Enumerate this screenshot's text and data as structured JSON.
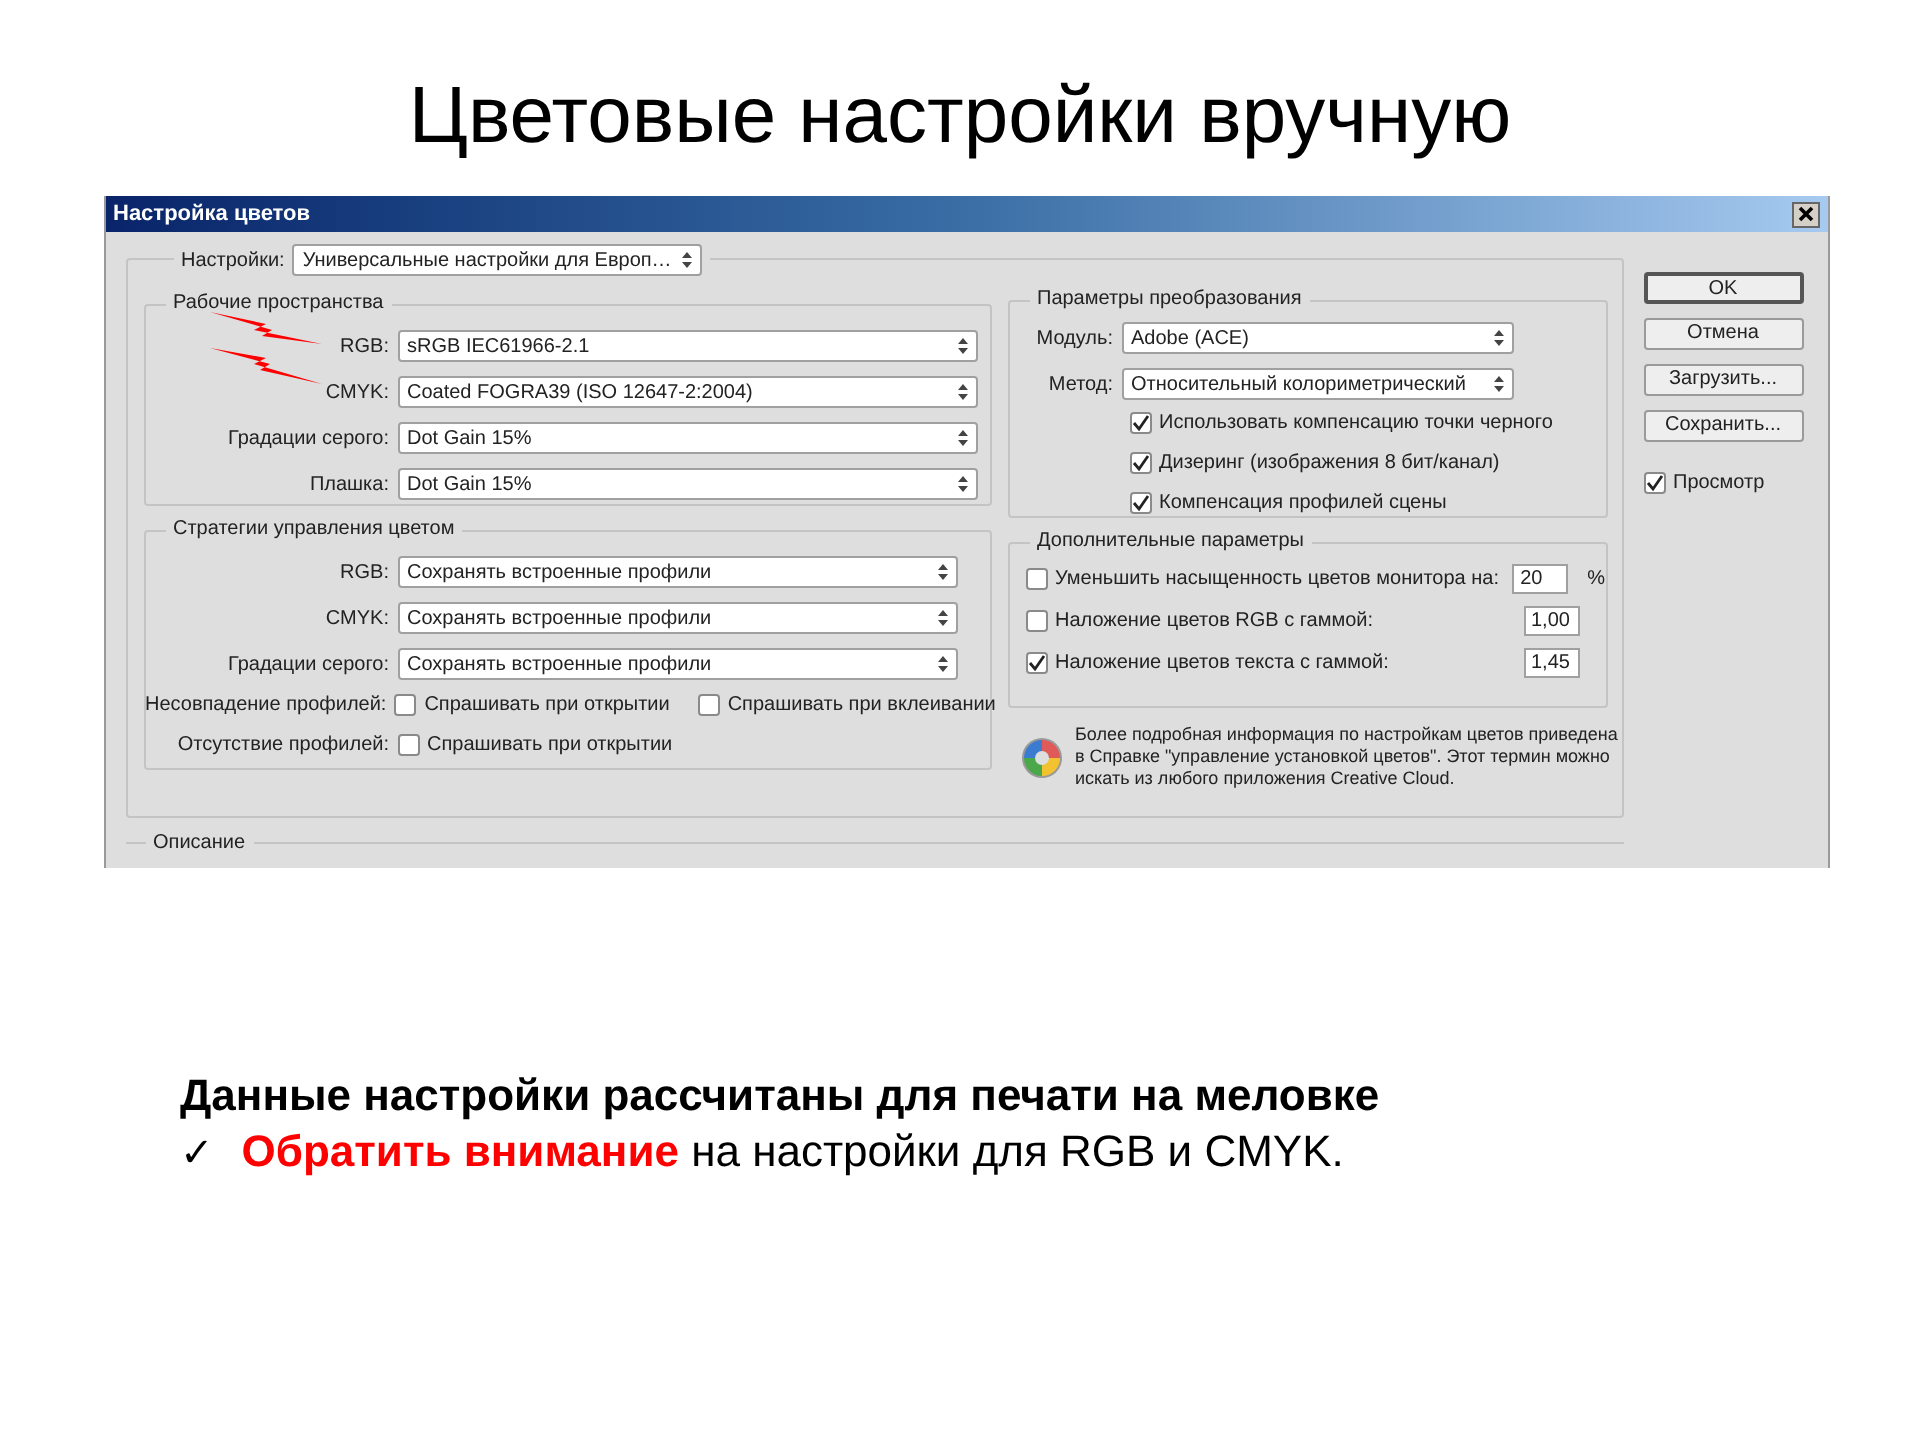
{
  "slide_title": "Цветовые настройки вручную",
  "dialog": {
    "title": "Настройка цветов",
    "settings": {
      "label": "Настройки:",
      "value": "Универсальные настройки для Европ…"
    },
    "working_spaces": {
      "title": "Рабочие пространства",
      "rows": [
        {
          "label": "RGB:",
          "value": "sRGB IEC61966-2.1"
        },
        {
          "label": "CMYK:",
          "value": "Coated FOGRA39 (ISO 12647-2:2004)"
        },
        {
          "label": "Градации серого:",
          "value": "Dot Gain 15%"
        },
        {
          "label": "Плашка:",
          "value": "Dot Gain 15%"
        }
      ]
    },
    "policies": {
      "title": "Стратегии управления цветом",
      "rows": [
        {
          "label": "RGB:",
          "value": "Сохранять встроенные профили"
        },
        {
          "label": "CMYK:",
          "value": "Сохранять встроенные профили"
        },
        {
          "label": "Градации серого:",
          "value": "Сохранять встроенные профили"
        }
      ],
      "checks": [
        {
          "label": "Несовпадение профилей:",
          "options": [
            {
              "label": "Спрашивать при открытии",
              "checked": false
            },
            {
              "label": "Спрашивать при вклеивании",
              "checked": false
            }
          ]
        },
        {
          "label": "Отсутствие профилей:",
          "options": [
            {
              "label": "Спрашивать при открытии",
              "checked": false
            }
          ]
        }
      ]
    },
    "conversion": {
      "title": "Параметры преобразования",
      "rows": [
        {
          "label": "Модуль:",
          "value": "Adobe (ACE)"
        },
        {
          "label": "Метод:",
          "value": "Относительный колориметрический"
        }
      ],
      "options": [
        {
          "label": "Использовать компенсацию точки черного",
          "checked": true
        },
        {
          "label": "Дизеринг (изображения 8 бит/канал)",
          "checked": true
        },
        {
          "label": "Компенсация профилей сцены",
          "checked": true
        }
      ]
    },
    "advanced": {
      "title": "Дополнительные параметры",
      "rows": [
        {
          "label": "Уменьшить насыщенность цветов монитора на:",
          "checked": false,
          "value": "20",
          "unit": "%"
        },
        {
          "label": "Наложение цветов RGB с гаммой:",
          "checked": false,
          "value": "1,00"
        },
        {
          "label": "Наложение цветов текста с гаммой:",
          "checked": true,
          "value": "1,45"
        }
      ]
    },
    "info": "Более подробная информация по настройкам цветов приведена в Справке \"управление установкой цветов\". Этот термин можно искать из любого приложения Creative Cloud.",
    "buttons": [
      {
        "label": "OK",
        "default": true
      },
      {
        "label": "Отмена",
        "default": false
      },
      {
        "label": "Загрузить...",
        "default": false
      },
      {
        "label": "Сохранить...",
        "default": false
      }
    ],
    "preview": {
      "label": "Просмотр",
      "checked": true
    },
    "description_title": "Описание"
  },
  "note": {
    "heading": "Данные настройки рассчитаны для печати на меловке",
    "bullet": "✓",
    "text": "**Обратить внимание** на настройки для RGB и CMYK."
  }
}
